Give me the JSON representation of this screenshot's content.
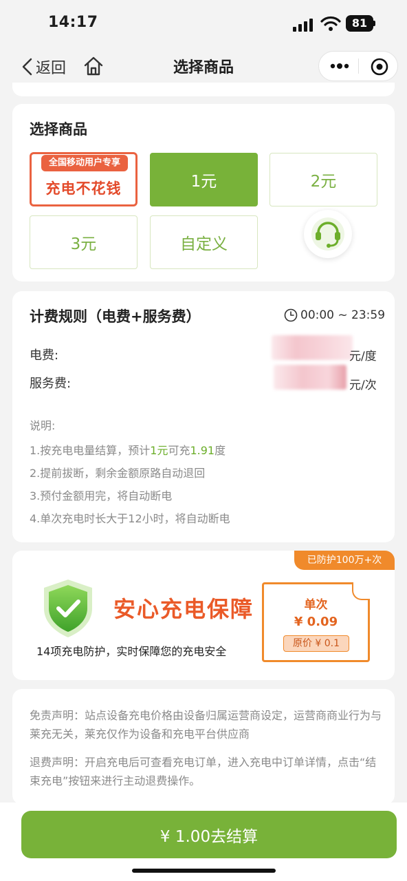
{
  "status_bar": {
    "time": "14:17",
    "battery": "81"
  },
  "nav": {
    "back_label": "返回",
    "title": "选择商品"
  },
  "products": {
    "title": "选择商品",
    "promo": {
      "badge": "全国移动用户专享",
      "text": "充电不花钱"
    },
    "items": [
      {
        "label": "1元",
        "selected": true
      },
      {
        "label": "2元",
        "selected": false
      },
      {
        "label": "3元",
        "selected": false
      },
      {
        "label": "自定义",
        "selected": false
      }
    ]
  },
  "billing": {
    "title": "计费规则（电费+服务费）",
    "time_range": "00:00 ~ 23:59",
    "electricity_label": "电费:",
    "electricity_unit": "元/度",
    "service_label": "服务费:",
    "service_unit": "元/次",
    "notes_title": "说明:",
    "note1_a": "1.按充电电量结算，预计",
    "note1_b": "1元",
    "note1_c": "可充",
    "note1_d": "1.91",
    "note1_e": "度",
    "note2": "2.提前拔断，剩余金额原路自动退回",
    "note3": "3.预付金额用完，将自动断电",
    "note4": "4.单次充电时长大于12小时，将自动断电"
  },
  "protection": {
    "badge": "已防护100万+次",
    "slogan": "安心充电保障",
    "subtitle": "14项充电防护，实时保障您的充电安全",
    "ticket_label": "单次",
    "ticket_price": "¥ 0.09",
    "ticket_original": "原价 ¥ 0.1"
  },
  "disclaimer": {
    "liability": "免责声明：站点设备充电价格由设备归属运营商设定，运营商商业行为与莱充无关，莱充仅作为设备和充电平台供应商",
    "refund": "退费声明：开启充电后可查看充电订单，进入充电中订单详情，点击“结束充电”按钮来进行主动退费操作。"
  },
  "checkout": {
    "label": "¥ 1.00去结算"
  },
  "colors": {
    "accent": "#78b239",
    "promo": "#ea6240",
    "orange": "#f08a2b"
  }
}
